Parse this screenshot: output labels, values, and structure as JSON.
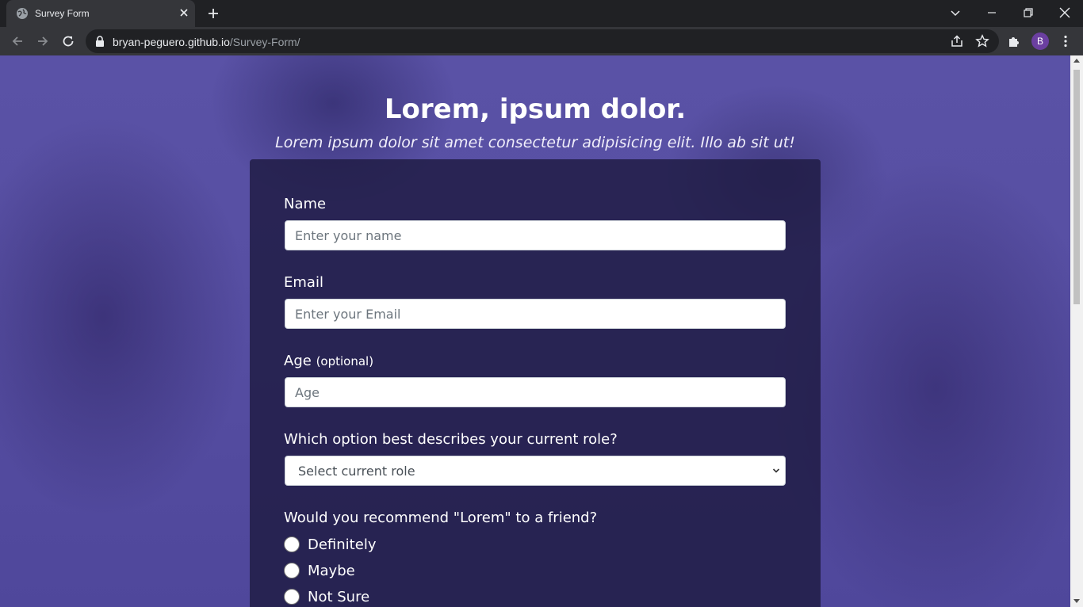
{
  "browser": {
    "tab_title": "Survey Form",
    "url_host": "bryan-peguero.github.io",
    "url_path": "/Survey-Form/",
    "profile_initial": "B"
  },
  "page": {
    "title": "Lorem, ipsum dolor.",
    "description": "Lorem ipsum dolor sit amet consectetur adipisicing elit. Illo ab sit ut!"
  },
  "form": {
    "name": {
      "label": "Name",
      "placeholder": "Enter your name"
    },
    "email": {
      "label": "Email",
      "placeholder": "Enter your Email"
    },
    "age": {
      "label": "Age",
      "label_note": "(optional)",
      "placeholder": "Age"
    },
    "role": {
      "label": "Which option best describes your current role?",
      "selected": "Select current role"
    },
    "recommend": {
      "label": "Would you recommend \"Lorem\" to a friend?",
      "options": [
        "Definitely",
        "Maybe",
        "Not Sure"
      ]
    }
  }
}
